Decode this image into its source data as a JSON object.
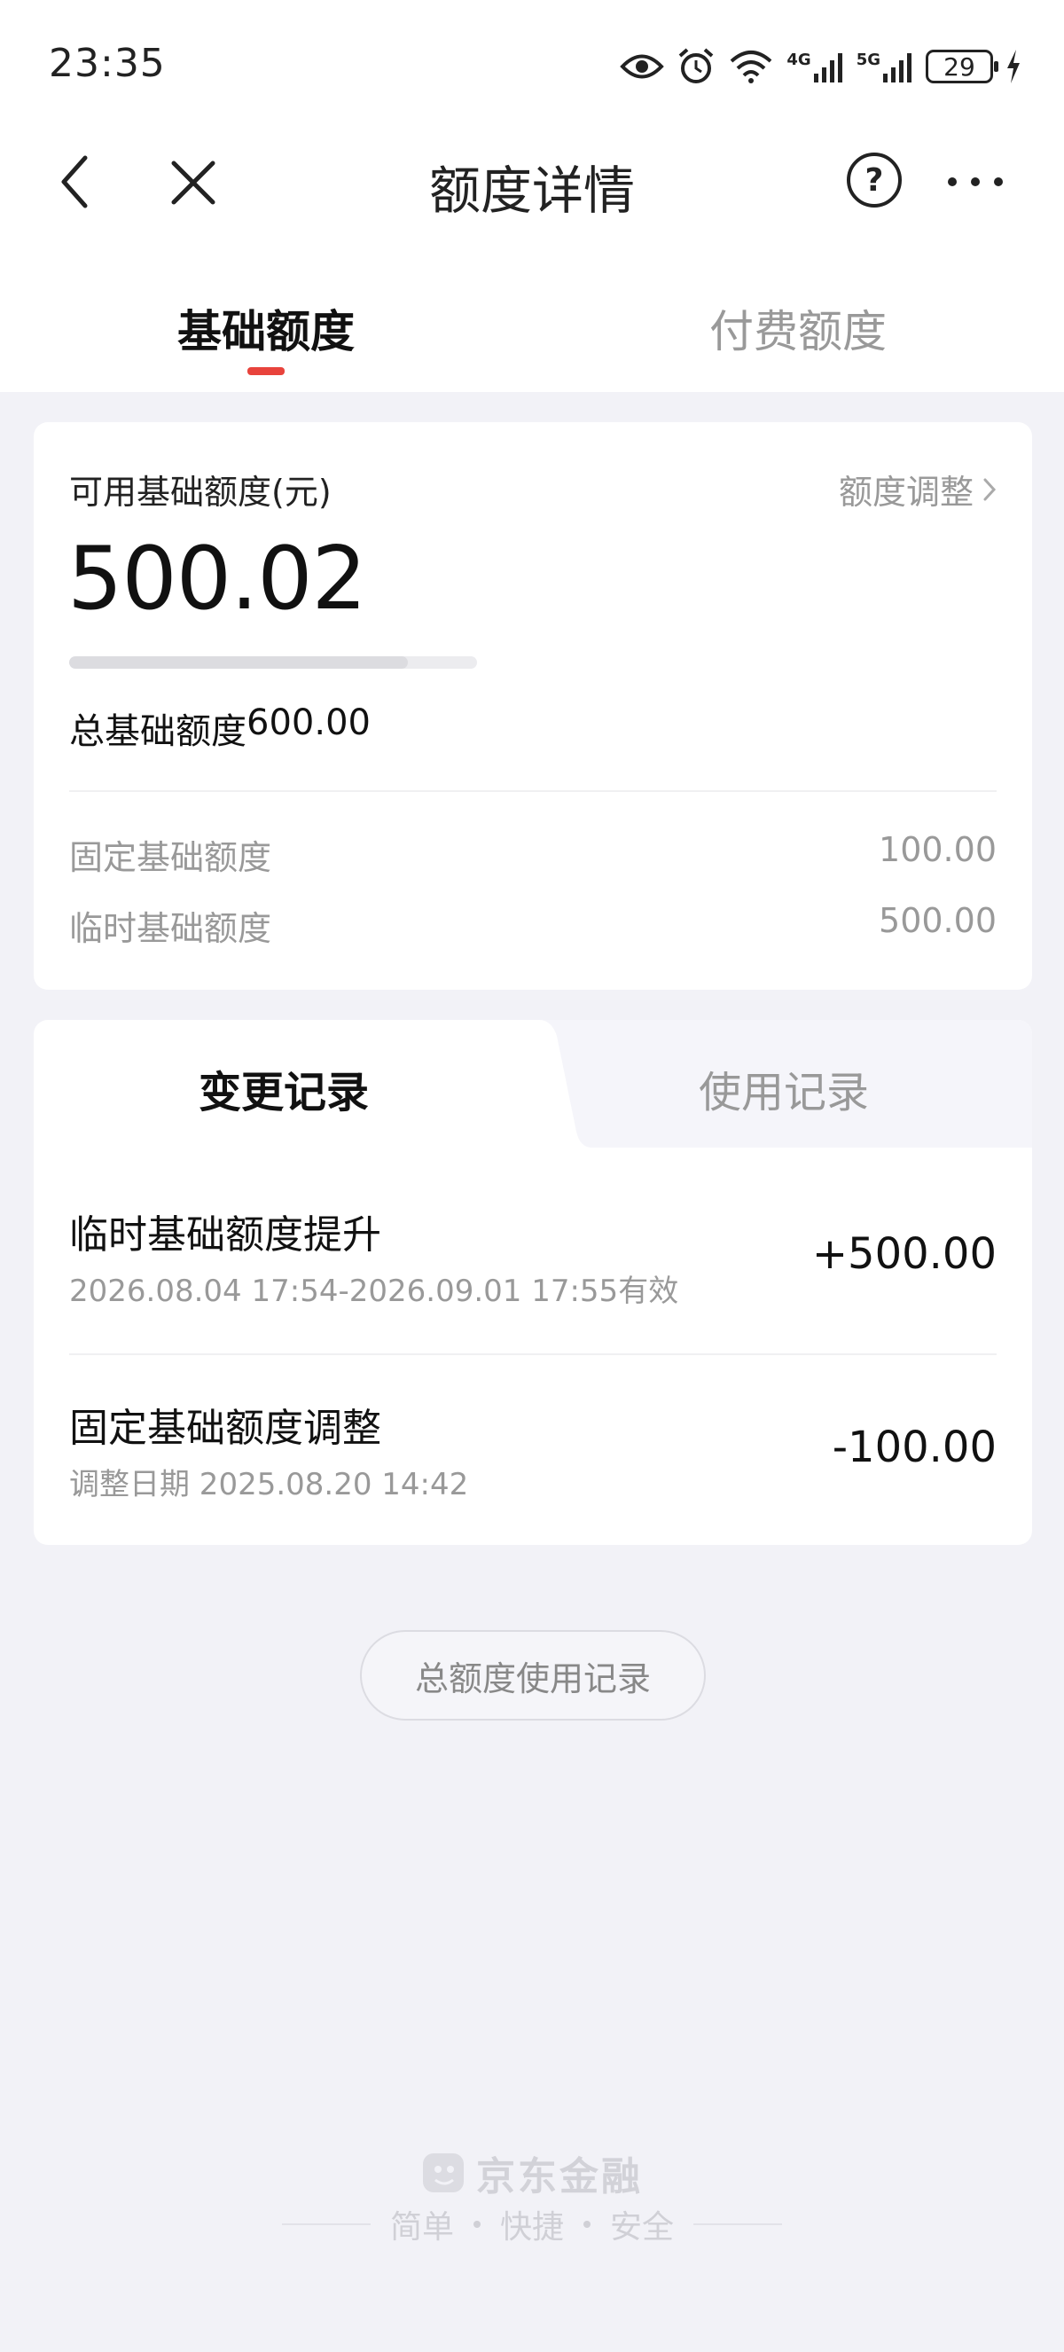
{
  "status_bar": {
    "time": "23:35",
    "net1": "4G",
    "net2": "5G",
    "battery": "29"
  },
  "nav": {
    "title": "额度详情",
    "help": "?"
  },
  "tabs": [
    {
      "label": "基础额度",
      "active": true
    },
    {
      "label": "付费额度",
      "active": false
    }
  ],
  "summary": {
    "available_label": "可用基础额度(元)",
    "adjust_label": "额度调整",
    "available_amount": "500.02",
    "usage_fraction": 0.83,
    "total_label": "总基础额度",
    "total_amount": "600.00",
    "fixed_label": "固定基础额度",
    "fixed_amount": "100.00",
    "temp_label": "临时基础额度",
    "temp_amount": "500.00"
  },
  "records": {
    "tabs": [
      {
        "label": "变更记录",
        "active": true
      },
      {
        "label": "使用记录",
        "active": false
      }
    ],
    "items": [
      {
        "title": "临时基础额度提升",
        "subtitle": "2026.08.04 17:54-2026.09.01 17:55有效",
        "amount": "+500.00"
      },
      {
        "title": "固定基础额度调整",
        "subtitle": "调整日期 2025.08.20 14:42",
        "amount": "-100.00"
      }
    ]
  },
  "total_usage_button": "总额度使用记录",
  "footer": {
    "brand": "京东金融",
    "slogan": [
      "简单",
      "快捷",
      "安全"
    ]
  },
  "colors": {
    "accent": "#e8433c",
    "background": "#f2f2f7"
  }
}
